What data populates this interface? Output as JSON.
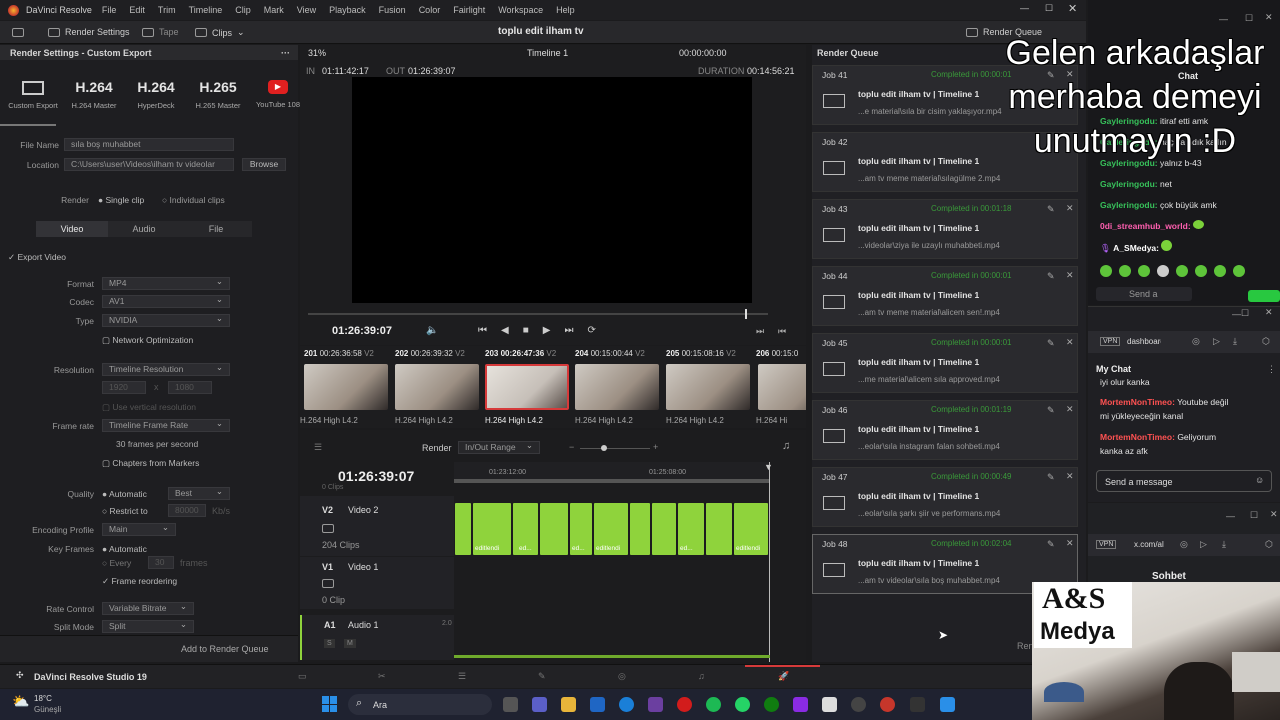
{
  "app": {
    "name": "DaVinci Resolve",
    "menu": [
      "File",
      "Edit",
      "Trim",
      "Timeline",
      "Clip",
      "Mark",
      "View",
      "Playback",
      "Fusion",
      "Color",
      "Fairlight",
      "Workspace",
      "Help"
    ],
    "project_title": "toplu edit ilham tv"
  },
  "toolbar": {
    "render_settings": "Render Settings",
    "tape": "Tape",
    "clips": "Clips",
    "render_queue": "Render Queue"
  },
  "left": {
    "header": "Render Settings - Custom Export",
    "presets": [
      {
        "big": "",
        "small": "Custom Export"
      },
      {
        "big": "H.264",
        "small": "H.264 Master"
      },
      {
        "big": "H.264",
        "small": "HyperDeck"
      },
      {
        "big": "H.265",
        "small": "H.265 Master"
      },
      {
        "big": "",
        "small": "YouTube 108"
      }
    ],
    "file_name_label": "File Name",
    "file_name": "sıla boş muhabbet",
    "location_label": "Location",
    "location": "C:\\Users\\user\\Videos\\ilham tv videolar",
    "browse": "Browse",
    "render_label": "Render",
    "single_clip": "Single clip",
    "individual_clips": "Individual clips",
    "tabs": [
      "Video",
      "Audio",
      "File"
    ],
    "export_video": "Export Video",
    "format_label": "Format",
    "format": "MP4",
    "codec_label": "Codec",
    "codec": "AV1",
    "type_label": "Type",
    "type": "NVIDIA",
    "network_opt": "Network Optimization",
    "resolution_label": "Resolution",
    "resolution": "Timeline Resolution",
    "res_w": "1920",
    "res_x": "x",
    "res_h": "1080",
    "use_vertical": "Use vertical resolution",
    "framerate_label": "Frame rate",
    "framerate": "Timeline Frame Rate",
    "fps_text": "30 frames per second",
    "chapters": "Chapters from Markers",
    "quality_label": "Quality",
    "automatic": "Automatic",
    "best": "Best",
    "restrict_to": "Restrict to",
    "restrict_val": "80000",
    "kbs": "Kb/s",
    "enc_profile_label": "Encoding Profile",
    "enc_profile": "Main",
    "keyframes_label": "Key Frames",
    "every": "Every",
    "every_val": "30",
    "frames": "frames",
    "frame_reordering": "Frame reordering",
    "rate_control_label": "Rate Control",
    "rate_control": "Variable Bitrate",
    "split_mode_label": "Split Mode",
    "split_mode": "Split",
    "add_to_queue": "Add to Render Queue"
  },
  "viewer": {
    "zoom": "31%",
    "timeline": "Timeline 1",
    "tc_top": "00:00:00:00",
    "in_label": "IN",
    "in": "01:11:42:17",
    "out_label": "OUT",
    "out": "01:26:39:07",
    "duration_label": "DURATION",
    "duration": "00:14:56:21",
    "tc_current": "01:26:39:07"
  },
  "thumbs": [
    {
      "num": "201",
      "tc": "00:26:36:58",
      "track": "V2",
      "name": "H.264 High L4.2"
    },
    {
      "num": "202",
      "tc": "00:26:39:32",
      "track": "V2",
      "name": "H.264 High L4.2"
    },
    {
      "num": "203",
      "tc": "00:26:47:36",
      "track": "V2",
      "name": "H.264 High L4.2"
    },
    {
      "num": "204",
      "tc": "00:15:00:44",
      "track": "V2",
      "name": "H.264 High L4.2"
    },
    {
      "num": "205",
      "tc": "00:15:08:16",
      "track": "V2",
      "name": "H.264 High L4.2"
    },
    {
      "num": "206",
      "tc": "00:15:0",
      "track": "",
      "name": "H.264 Hi"
    }
  ],
  "timeline": {
    "render_label": "Render",
    "render_range": "In/Out Range",
    "tc": "01:26:39:07",
    "ruler": [
      "01:23:12:00",
      "01:25:08:00"
    ],
    "clips_cut": "0 Clips",
    "v2": "V2",
    "v2_name": "Video 2",
    "v2_clips": "204 Clips",
    "v1": "V1",
    "v1_name": "Video 1",
    "v1_clips": "0 Clip",
    "a1": "A1",
    "a1_name": "Audio 1",
    "a1_level": "2.0",
    "s": "S",
    "m": "M",
    "clip_label": "editlendi",
    "clip_short": "ed..."
  },
  "render_queue": {
    "title": "Render Queue",
    "jobs": [
      {
        "id": "Job 41",
        "status": "Completed in 00:00:01",
        "title": "toplu edit ilham tv | Timeline 1",
        "file": "...e material\\sıla bir cisim yaklaşıyor.mp4"
      },
      {
        "id": "Job 42",
        "status": "",
        "title": "toplu edit ilham tv | Timeline 1",
        "file": "...am tv meme material\\sılagülme 2.mp4"
      },
      {
        "id": "Job 43",
        "status": "Completed in 00:01:18",
        "title": "toplu edit ilham tv | Timeline 1",
        "file": "...videolar\\ziya ile uzaylı muhabbeti.mp4"
      },
      {
        "id": "Job 44",
        "status": "Completed in 00:00:01",
        "title": "toplu edit ilham tv | Timeline 1",
        "file": "...am tv meme material\\alicem sen!.mp4"
      },
      {
        "id": "Job 45",
        "status": "Completed in 00:00:01",
        "title": "toplu edit ilham tv | Timeline 1",
        "file": "...me material\\alicem sıla approved.mp4"
      },
      {
        "id": "Job 46",
        "status": "Completed in 00:01:19",
        "title": "toplu edit ilham tv | Timeline 1",
        "file": "...eolar\\sıla instagram falan sohbeti.mp4"
      },
      {
        "id": "Job 47",
        "status": "Completed in 00:00:49",
        "title": "toplu edit ilham tv | Timeline 1",
        "file": "...eolar\\sıla şarkı şiir ve performans.mp4"
      },
      {
        "id": "Job 48",
        "status": "Completed in 00:02:04",
        "title": "toplu edit ilham tv | Timeline 1",
        "file": "...am tv videolar\\sıla boş muhabbet.mp4"
      }
    ],
    "render_btn": "Ren"
  },
  "bottombar": {
    "product": "DaVinci Resolve Studio 19"
  },
  "taskbar": {
    "temp": "18°C",
    "weather": "Güneşli",
    "search": "Ara"
  },
  "overlay": {
    "line1": "Gelen arkadaşlar",
    "line2": "merhaba demeyi",
    "line3": "unutmayın :D"
  },
  "chat1": {
    "title": "Chat",
    "send": "Send a",
    "messages": [
      {
        "user": "Gayleringodu:",
        "text": "itiraf etti amk"
      },
      {
        "user": "Gayleringodu:",
        "text": "naç ya ndık kadın"
      },
      {
        "user": "Gayleringodu:",
        "text": "yalnız b-43"
      },
      {
        "user": "Gayleringodu:",
        "text": "net"
      },
      {
        "user": "Gayleringodu:",
        "text": "çok büyük amk"
      },
      {
        "user": "0di_streamhub_world:",
        "text": ""
      },
      {
        "user": "A_SMedya:",
        "text": ""
      }
    ]
  },
  "chat2": {
    "url": "dashboard",
    "vpn": "VPN",
    "title": "My Chat",
    "messages": [
      {
        "user": "",
        "text": "iyi olur kanka"
      },
      {
        "user": "MortemNonTimeo:",
        "text": "Youtube değil"
      },
      {
        "user": "",
        "text": "mi yükleyeceğin kanal"
      },
      {
        "user": "MortemNonTimeo:",
        "text": "Geliyorum"
      },
      {
        "user": "",
        "text": "kanka az afk"
      }
    ],
    "send": "Send a message"
  },
  "chat3": {
    "url": "x.com/al",
    "vpn": "VPN",
    "title": "Sohbet"
  },
  "webcam": {
    "logo1": "A&S",
    "logo2": "Medya"
  },
  "colors": {
    "accent": "#8fd33c",
    "completed": "#3a9a3a",
    "selection": "#d63a3a"
  }
}
